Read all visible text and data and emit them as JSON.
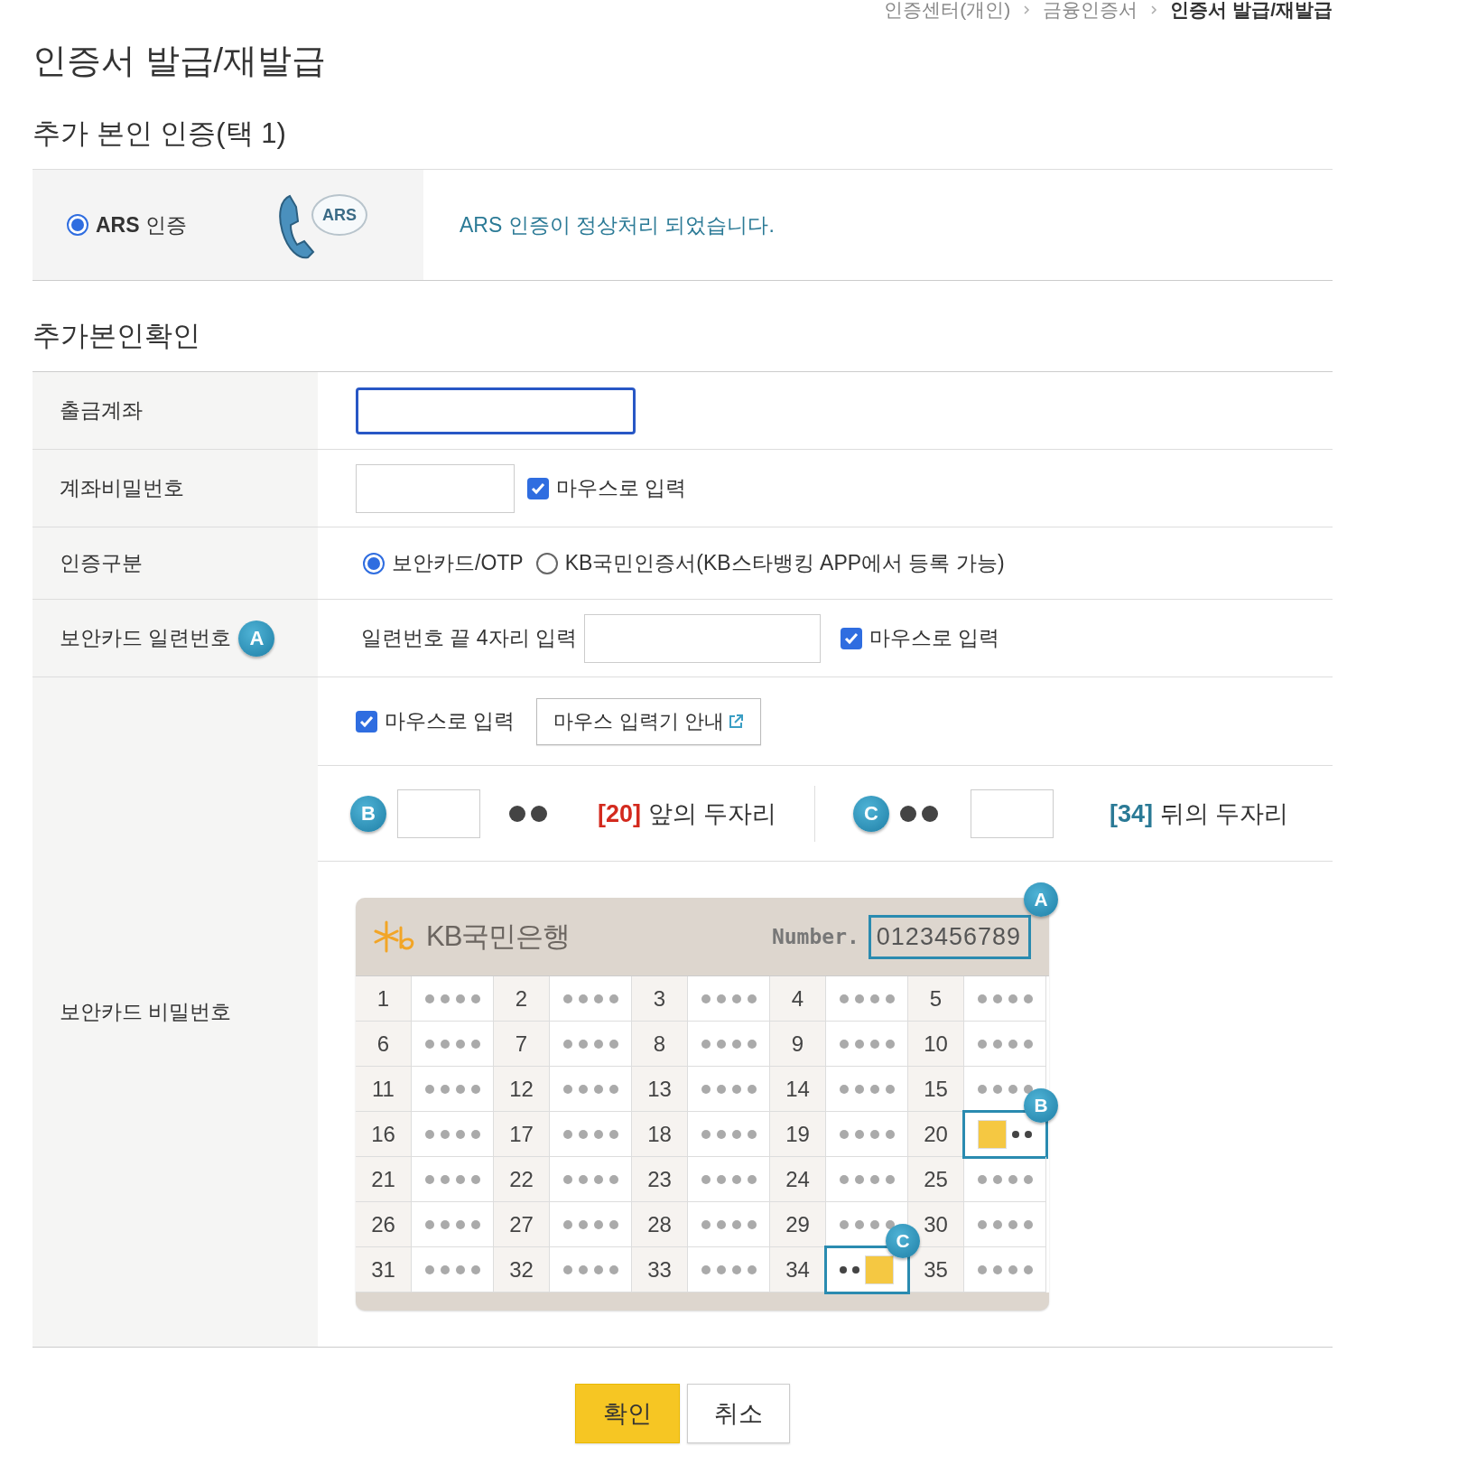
{
  "breadcrumb": [
    {
      "label": "인증센터(개인)",
      "current": false
    },
    {
      "label": "금융인증서",
      "current": false
    },
    {
      "label": "인증서 발급/재발급",
      "current": true
    }
  ],
  "page_title": "인증서 발급/재발급",
  "auth_section": {
    "title": "추가 본인 인증(택 1)",
    "options": [
      {
        "label": "**ARS** 인증",
        "selected": true,
        "illustration_text": "ARS"
      }
    ],
    "message": "ARS 인증이 정상처리 되었습니다."
  },
  "confirm_section": {
    "title": "추가본인확인",
    "rows": [
      {
        "kind": "account",
        "label": "출금계좌",
        "focused": true
      },
      {
        "kind": "password",
        "label": "계좌비밀번호",
        "mouse_input": {
          "label": "마우스로 입력",
          "checked": true
        }
      },
      {
        "kind": "radio",
        "label": "인증구분",
        "options": [
          {
            "label": "보안카드/OTP",
            "selected": true
          },
          {
            "label": "KB국민인증서(KB스타뱅킹 APP에서 등록 가능)",
            "selected": false
          }
        ]
      },
      {
        "kind": "serial",
        "label": "보안카드 일련번호",
        "badge": "A",
        "prompt": "일련번호 끝 4자리 입력",
        "mouse_input": {
          "label": "마우스로 입력",
          "checked": true
        }
      },
      {
        "kind": "card",
        "label": "보안카드 비밀번호",
        "mouse_input": {
          "label": "마우스로 입력",
          "checked": true
        },
        "guide_button": "마우스 입력기 안내",
        "front": {
          "badge": "B",
          "index": "[20]",
          "text": "앞의 두자리"
        },
        "back": {
          "badge": "C",
          "index": "[34]",
          "text": "뒤의 두자리"
        },
        "card": {
          "bank": "KB국민은행",
          "number_label": "Number.",
          "number": "0123456789",
          "serial_badge": "A",
          "cells": [
            {
              "no": "1",
              "kind": "hidden"
            },
            {
              "no": "2",
              "kind": "hidden"
            },
            {
              "no": "3",
              "kind": "hidden"
            },
            {
              "no": "4",
              "kind": "hidden"
            },
            {
              "no": "5",
              "kind": "hidden"
            },
            {
              "no": "6",
              "kind": "hidden"
            },
            {
              "no": "7",
              "kind": "hidden"
            },
            {
              "no": "8",
              "kind": "hidden"
            },
            {
              "no": "9",
              "kind": "hidden"
            },
            {
              "no": "10",
              "kind": "hidden"
            },
            {
              "no": "11",
              "kind": "hidden"
            },
            {
              "no": "12",
              "kind": "hidden"
            },
            {
              "no": "13",
              "kind": "hidden"
            },
            {
              "no": "14",
              "kind": "hidden"
            },
            {
              "no": "15",
              "kind": "hidden"
            },
            {
              "no": "16",
              "kind": "hidden"
            },
            {
              "no": "17",
              "kind": "hidden"
            },
            {
              "no": "18",
              "kind": "hidden"
            },
            {
              "no": "19",
              "kind": "hidden"
            },
            {
              "no": "20",
              "kind": "first-two",
              "badge": "B"
            },
            {
              "no": "21",
              "kind": "hidden"
            },
            {
              "no": "22",
              "kind": "hidden"
            },
            {
              "no": "23",
              "kind": "hidden"
            },
            {
              "no": "24",
              "kind": "hidden"
            },
            {
              "no": "25",
              "kind": "hidden"
            },
            {
              "no": "26",
              "kind": "hidden"
            },
            {
              "no": "27",
              "kind": "hidden"
            },
            {
              "no": "28",
              "kind": "hidden"
            },
            {
              "no": "29",
              "kind": "hidden"
            },
            {
              "no": "30",
              "kind": "hidden"
            },
            {
              "no": "31",
              "kind": "hidden"
            },
            {
              "no": "32",
              "kind": "hidden"
            },
            {
              "no": "33",
              "kind": "hidden"
            },
            {
              "no": "34",
              "kind": "last-two",
              "badge": "C"
            },
            {
              "no": "35",
              "kind": "hidden"
            }
          ]
        }
      }
    ]
  },
  "buttons": [
    {
      "label": "확인",
      "kind": "primary"
    },
    {
      "label": "취소",
      "kind": "secondary"
    }
  ]
}
